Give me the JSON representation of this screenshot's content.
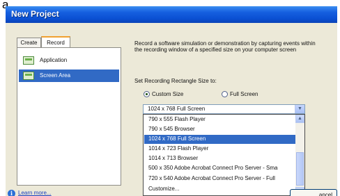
{
  "corner_label": "a",
  "window": {
    "title": "New Project"
  },
  "tabs": [
    {
      "label": "Create",
      "active": false
    },
    {
      "label": "Record",
      "active": true
    }
  ],
  "modes": [
    {
      "label": "Application",
      "icon": "application-window-icon",
      "selected": false
    },
    {
      "label": "Screen Area",
      "icon": "screen-area-icon",
      "selected": true
    }
  ],
  "description": "Record a software simulation or demonstration by capturing events within the recording window of a specified size on your computer screen",
  "set_rect_label": "Set Recording Rectangle Size to:",
  "radios": [
    {
      "label": "Custom Size",
      "checked": true
    },
    {
      "label": "Full Screen",
      "checked": false
    }
  ],
  "size_combo": {
    "value": "1024 x 768 Full Screen"
  },
  "size_options": [
    {
      "label": "790 x 555 Flash Player",
      "selected": false
    },
    {
      "label": "790 x 545 Browser",
      "selected": false
    },
    {
      "label": "1024 x 768 Full Screen",
      "selected": true
    },
    {
      "label": "1014 x 723 Flash Player",
      "selected": false
    },
    {
      "label": "1014 x 713 Browser",
      "selected": false
    },
    {
      "label": "500 x 350 Adobe Acrobat Connect Pro Server - Sma",
      "selected": false
    },
    {
      "label": "720 x 540 Adobe Acrobat Connect Pro Server - Full",
      "selected": false
    },
    {
      "label": "Customize...",
      "selected": false
    }
  ],
  "learn_more": "Learn more...",
  "cancel_label": "ancel",
  "colors": {
    "title_bar": "#0a4fd2",
    "selection": "#316ac5",
    "dialog_bg": "#ece9d8"
  }
}
